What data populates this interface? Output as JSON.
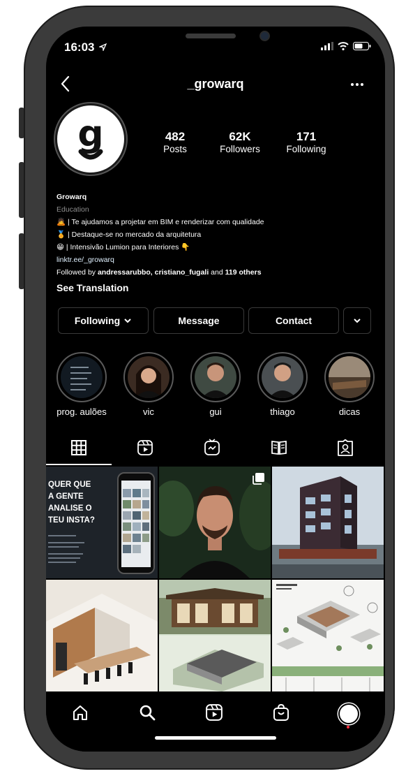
{
  "status_bar": {
    "time": "16:03"
  },
  "header": {
    "username": "_growarq"
  },
  "profile": {
    "avatar_letter": "g",
    "stats": [
      {
        "value": "482",
        "label": "Posts"
      },
      {
        "value": "62K",
        "label": "Followers"
      },
      {
        "value": "171",
        "label": "Following"
      }
    ],
    "name": "Growarq",
    "category": "Education",
    "bio_lines": [
      {
        "emoji": "🙇",
        "text": "| Te ajudamos a projetar em BIM e renderizar com qualidade"
      },
      {
        "emoji": "🏅",
        "text": "| Destaque-se no mercado da arquitetura"
      },
      {
        "emoji": "😁",
        "text": "| Intensivão Lumion para Interiores 👇"
      }
    ],
    "link": "linktr.ee/_growarq",
    "followed_by": {
      "prefix": "Followed by ",
      "names": "andressarubbo, cristiano_fugali",
      "middle": " and ",
      "others": "119 others"
    },
    "see_translation": "See Translation"
  },
  "actions": {
    "following": "Following",
    "message": "Message",
    "contact": "Contact"
  },
  "highlights": [
    {
      "label": "prog. aulões"
    },
    {
      "label": "vic"
    },
    {
      "label": "gui"
    },
    {
      "label": "thiago"
    },
    {
      "label": "dicas"
    }
  ],
  "posts": {
    "first": {
      "lines": [
        "QUER QUE",
        "A GENTE",
        "ANALISE O",
        "TEU INSTA?"
      ]
    }
  }
}
